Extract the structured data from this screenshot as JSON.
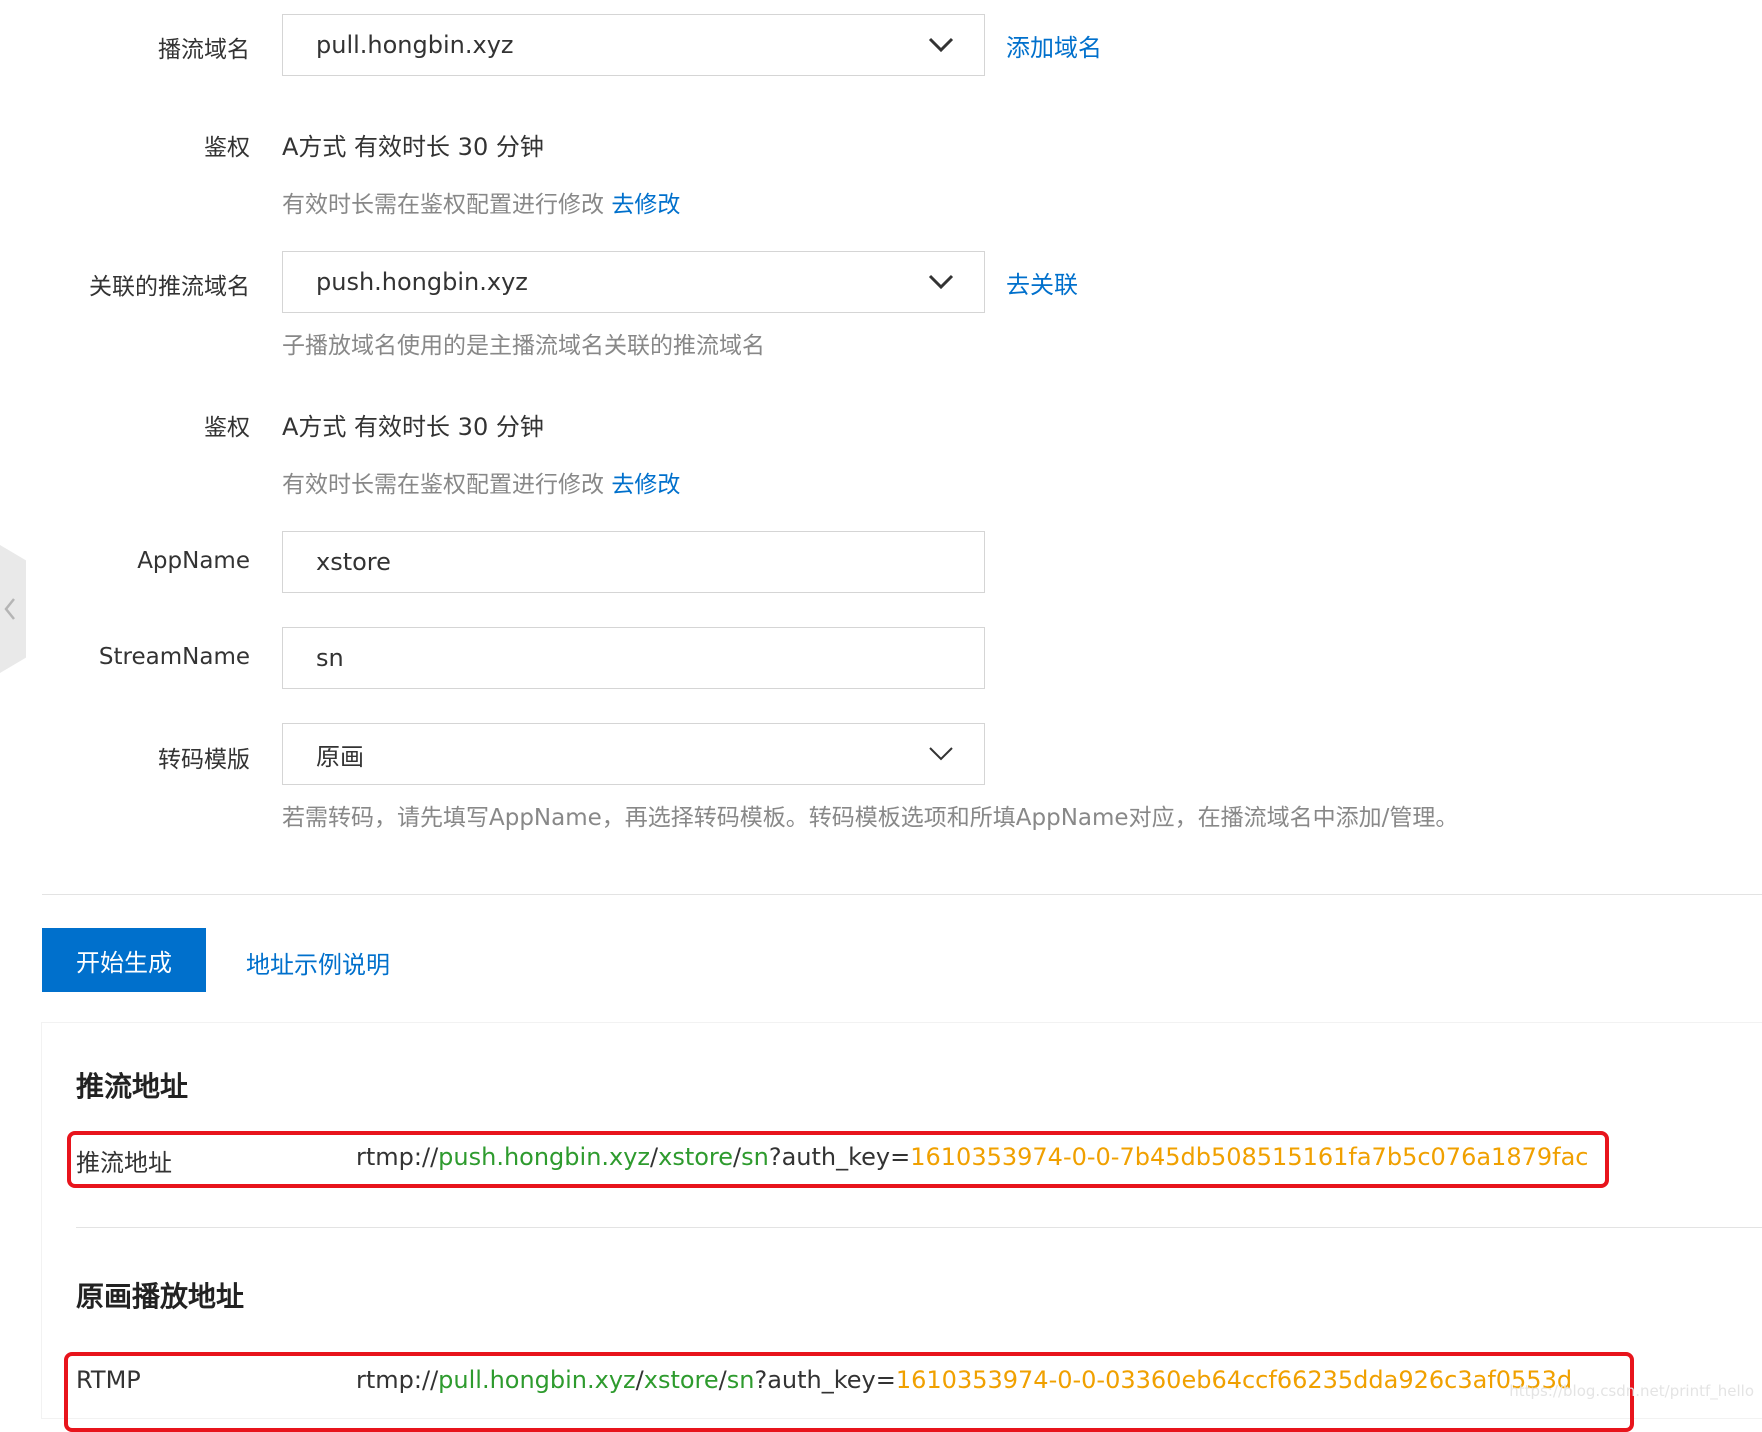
{
  "form": {
    "pull_domain": {
      "label": "播流域名",
      "value": "pull.hongbin.xyz",
      "action": "添加域名"
    },
    "auth1": {
      "label": "鉴权",
      "value": "A方式 有效时长 30 分钟",
      "hint": "有效时长需在鉴权配置进行修改",
      "link": "去修改"
    },
    "push_domain": {
      "label": "关联的推流域名",
      "value": "push.hongbin.xyz",
      "action": "去关联",
      "hint": "子播放域名使用的是主播流域名关联的推流域名"
    },
    "auth2": {
      "label": "鉴权",
      "value": "A方式 有效时长 30 分钟",
      "hint": "有效时长需在鉴权配置进行修改",
      "link": "去修改"
    },
    "app_name": {
      "label": "AppName",
      "value": "xstore"
    },
    "stream_name": {
      "label": "StreamName",
      "value": "sn"
    },
    "transcode": {
      "label": "转码模版",
      "value": "原画",
      "hint": "若需转码，请先填写AppName，再选择转码模板。转码模板选项和所填AppName对应，在播流域名中添加/管理。"
    }
  },
  "actions": {
    "generate": "开始生成",
    "example_link": "地址示例说明"
  },
  "results": {
    "push": {
      "title": "推流地址",
      "row_label": "推流地址",
      "url": {
        "scheme": "rtmp://",
        "domain": "push.hongbin.xyz",
        "sep1": "/",
        "app": "xstore",
        "sep2": "/",
        "stream": "sn",
        "query": "?auth_key=",
        "key": "1610353974-0-0-7b45db508515161fa7b5c076a1879fac"
      }
    },
    "play": {
      "title": "原画播放地址",
      "row_label": "RTMP",
      "url": {
        "scheme": "rtmp://",
        "domain": "pull.hongbin.xyz",
        "sep1": "/",
        "app": "xstore",
        "sep2": "/",
        "stream": "sn",
        "query": "?auth_key=",
        "key": "1610353974-0-0-03360eb64ccf66235dda926c3af0553d"
      }
    }
  },
  "watermark": "https://blog.csdn.net/printf_hello",
  "colors": {
    "link": "#0070cc",
    "primary": "#0070cc",
    "url_green": "#2e9b2e",
    "url_orange": "#f0a000",
    "highlight_red": "#e8141c"
  },
  "icons": {
    "dropdown": "chevron-down-icon",
    "side_tab": "chevron-left-icon"
  }
}
